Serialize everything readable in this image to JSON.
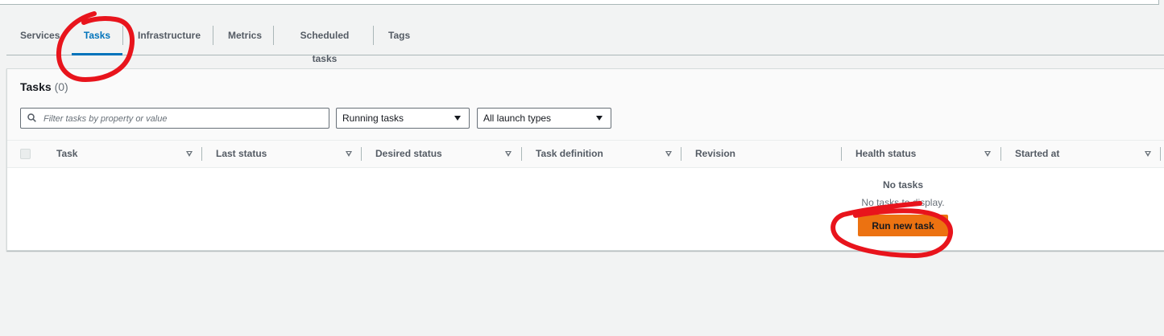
{
  "tabs": [
    {
      "label": "Services",
      "active": false
    },
    {
      "label": "Tasks",
      "active": true
    },
    {
      "label": "Infrastructure",
      "active": false
    },
    {
      "label": "Metrics",
      "active": false
    },
    {
      "label": "Scheduled tasks",
      "active": false
    },
    {
      "label": "Tags",
      "active": false
    }
  ],
  "panel": {
    "title": "Tasks",
    "count": "(0)",
    "filter_placeholder": "Filter tasks by property or value",
    "status_select": "Running tasks",
    "launch_select": "All launch types"
  },
  "table": {
    "columns": [
      "Task",
      "Last status",
      "Desired status",
      "Task definition",
      "Revision",
      "Health status",
      "Started at"
    ],
    "empty_title": "No tasks",
    "empty_desc": "No tasks to display.",
    "run_button": "Run new task"
  },
  "colors": {
    "accent": "#0073bb",
    "primary_button": "#ec7211",
    "annotation": "#e8141c",
    "page_background": "#f2f3f3"
  }
}
